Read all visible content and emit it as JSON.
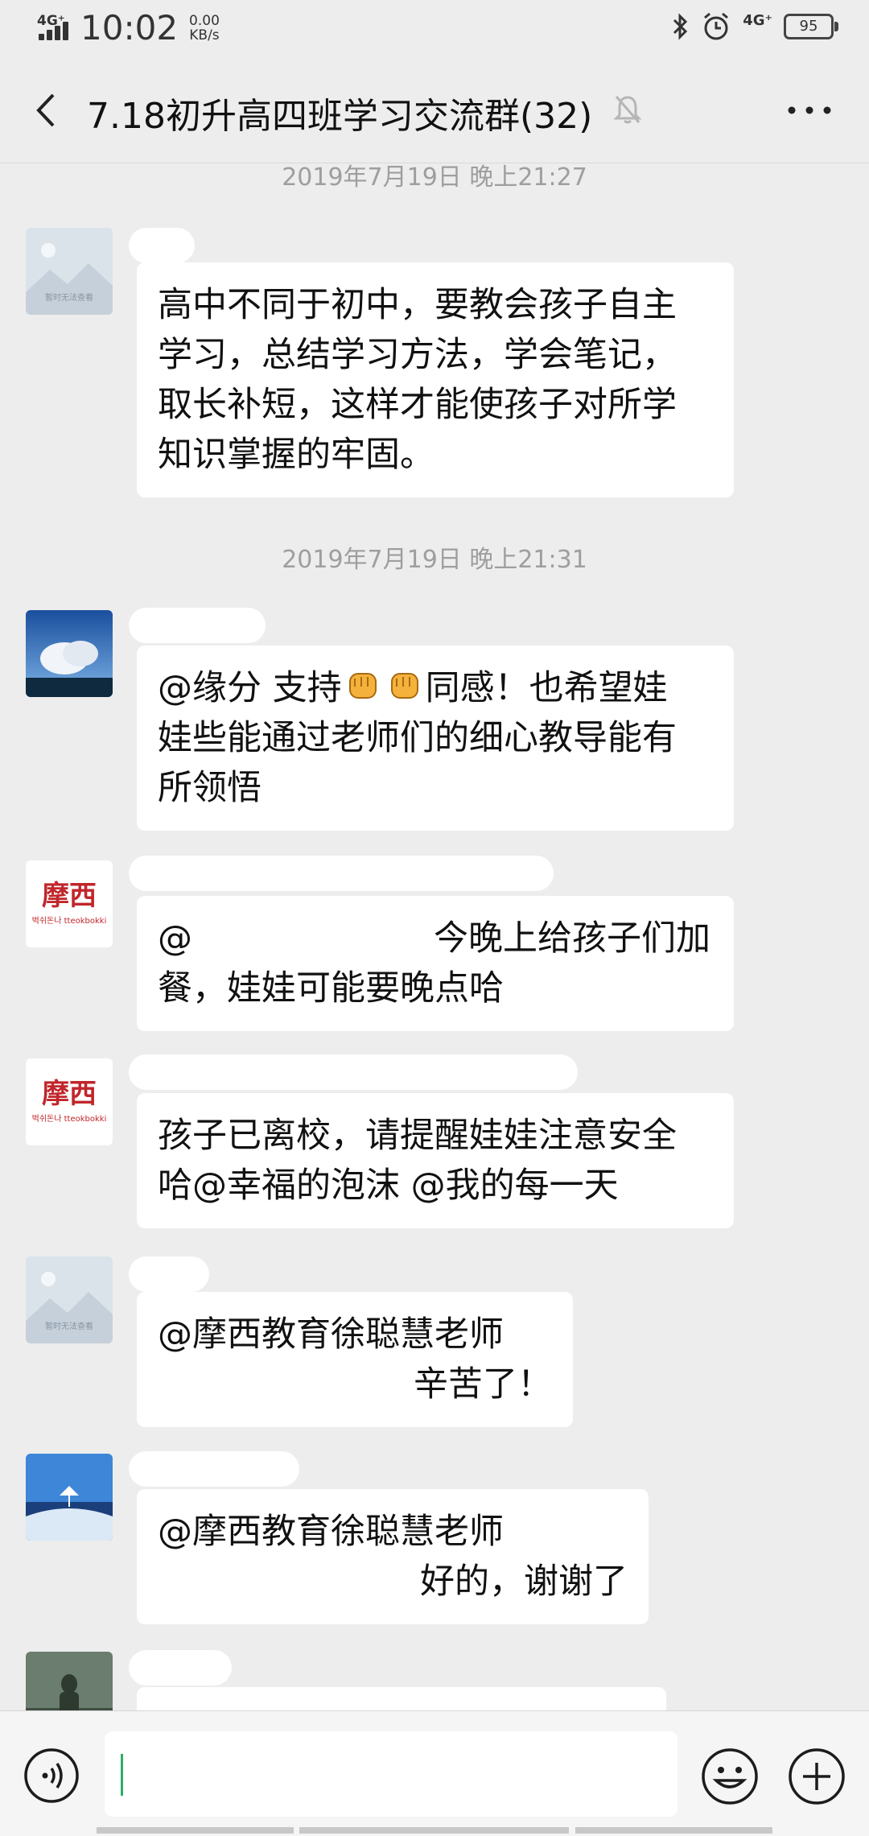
{
  "status_bar": {
    "network": "4G⁺",
    "time": "10:02",
    "speed_value": "0.00",
    "speed_unit": "KB/s",
    "network_right": "4G⁺",
    "battery": "95"
  },
  "header": {
    "title": "7.18初升高四班学习交流群(32)"
  },
  "chat": {
    "timestamps": [
      "2019年7月19日 晚上21:27",
      "2019年7月19日 晚上21:31"
    ],
    "avatar_placeholder_text": "暂时无法查看",
    "avatar_logo_text": "摩西",
    "avatar_logo_sub": "벅쉬돈나 tteokbokki",
    "messages": [
      {
        "lines": [
          "高中不同于初中，要教会孩子自主",
          "学习，总结学习方法，学会笔记，",
          "取长补短，这样才能使孩子对所学",
          "知识掌握的牢固。"
        ]
      },
      {
        "line1_a": "@缘分  支持",
        "line1_b": "同感！也希望娃",
        "lines_rest": [
          "娃些能通过老师们的细心教导能有",
          "所领悟"
        ]
      },
      {
        "line1_prefix": "@",
        "line1_tail": "今晚上给孩子们加",
        "line2": "餐，娃娃可能要晚点哈"
      },
      {
        "lines": [
          "孩子已离校，请提醒娃娃注意安全",
          "哈@幸福的泡沫  @我的每一天"
        ]
      },
      {
        "line1": "@摩西教育徐聪慧老师",
        "line2": "辛苦了！"
      },
      {
        "line1": "@摩西教育徐聪慧老师",
        "line2": "好的，谢谢了"
      }
    ]
  },
  "colors": {
    "background": "#ededed",
    "bubble": "#ffffff",
    "cursor": "#2aae67",
    "logo_red": "#c0262b"
  }
}
